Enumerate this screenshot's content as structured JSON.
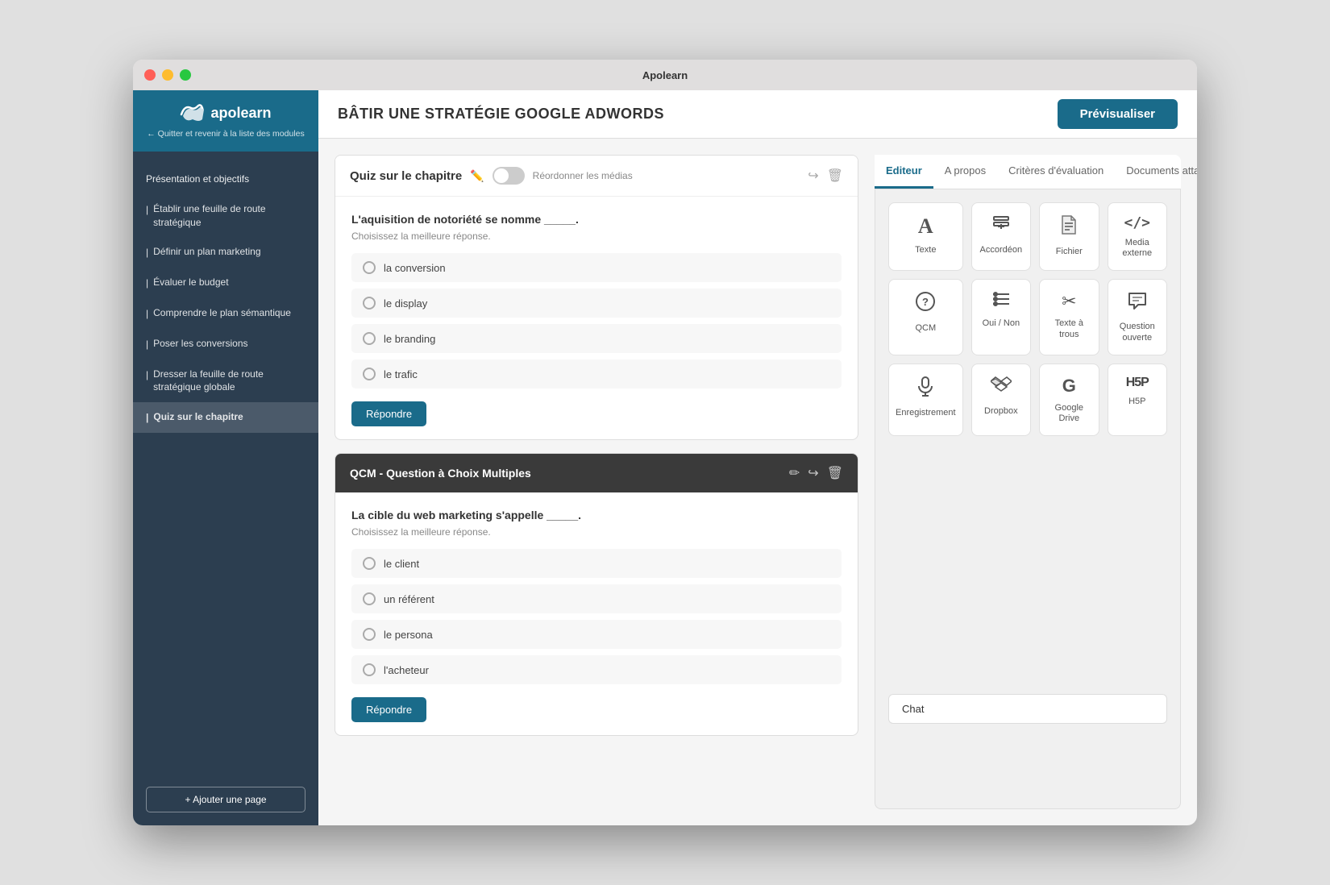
{
  "window": {
    "title": "Apolearn"
  },
  "topbar": {
    "page_title": "BÂTIR UNE STRATÉGIE GOOGLE ADWORDS",
    "preview_label": "Prévisualiser"
  },
  "sidebar": {
    "logo_text": "apolearn",
    "back_link": "← Quitter et revenir à la liste des modules",
    "items": [
      {
        "id": "presentation",
        "label": "Présentation et objectifs",
        "bullet": false
      },
      {
        "id": "feuille-route",
        "label": "Établir une feuille de route stratégique",
        "bullet": true
      },
      {
        "id": "plan-marketing",
        "label": "Définir un plan marketing",
        "bullet": true
      },
      {
        "id": "budget",
        "label": "Évaluer le budget",
        "bullet": true
      },
      {
        "id": "plan-semantique",
        "label": "Comprendre le plan sémantique",
        "bullet": true
      },
      {
        "id": "conversions",
        "label": "Poser les conversions",
        "bullet": true
      },
      {
        "id": "feuille-route-globale",
        "label": "Dresser la feuille de route stratégique globale",
        "bullet": true
      },
      {
        "id": "quiz",
        "label": "Quiz sur le chapitre",
        "bullet": true,
        "active": true
      }
    ],
    "add_page_label": "+ Ajouter une page"
  },
  "quiz_card1": {
    "title": "Quiz sur le chapitre",
    "reorder_label": "Réordonner les médias",
    "question": "L'aquisition de notoriété se nomme _____.",
    "choose_text": "Choisissez la meilleure réponse.",
    "options": [
      "la conversion",
      "le display",
      "le branding",
      "le trafic"
    ],
    "answer_label": "Répondre"
  },
  "qcm_card": {
    "title": "QCM - Question à Choix Multiples",
    "question": "La cible du web marketing s'appelle _____.",
    "choose_text": "Choisissez la meilleure réponse.",
    "options": [
      "le client",
      "un référent",
      "le persona",
      "l'acheteur"
    ],
    "answer_label": "Répondre"
  },
  "right_panel": {
    "tabs": [
      {
        "id": "editeur",
        "label": "Editeur",
        "active": true
      },
      {
        "id": "apropos",
        "label": "A propos",
        "active": false
      },
      {
        "id": "criteres",
        "label": "Critères d'évaluation",
        "active": false
      },
      {
        "id": "documents",
        "label": "Documents attachés",
        "active": false
      }
    ],
    "content_items": [
      {
        "id": "texte",
        "icon": "A",
        "icon_type": "letter",
        "label": "Texte"
      },
      {
        "id": "accordeon",
        "icon": "⊞",
        "icon_type": "unicode",
        "label": "Accordéon"
      },
      {
        "id": "fichier",
        "icon": "📄",
        "icon_type": "unicode",
        "label": "Fichier"
      },
      {
        "id": "media-externe",
        "icon": "</>",
        "icon_type": "text",
        "label": "Media externe"
      },
      {
        "id": "qcm",
        "icon": "?",
        "icon_type": "letter-circle",
        "label": "QCM"
      },
      {
        "id": "oui-non",
        "icon": "≡",
        "icon_type": "unicode",
        "label": "Oui / Non"
      },
      {
        "id": "texte-a-trous",
        "icon": "✂",
        "icon_type": "unicode",
        "label": "Texte à trous"
      },
      {
        "id": "question-ouverte",
        "icon": "💬",
        "icon_type": "unicode",
        "label": "Question ouverte"
      },
      {
        "id": "enregistrement",
        "icon": "🎙",
        "icon_type": "unicode",
        "label": "Enregistrement"
      },
      {
        "id": "dropbox",
        "icon": "◈",
        "icon_type": "unicode",
        "label": "Dropbox"
      },
      {
        "id": "google-drive",
        "icon": "G",
        "icon_type": "letter",
        "label": "Google Drive"
      },
      {
        "id": "h5p",
        "icon": "H5P",
        "icon_type": "text",
        "label": "H5P"
      }
    ],
    "chat_label": "Chat"
  }
}
